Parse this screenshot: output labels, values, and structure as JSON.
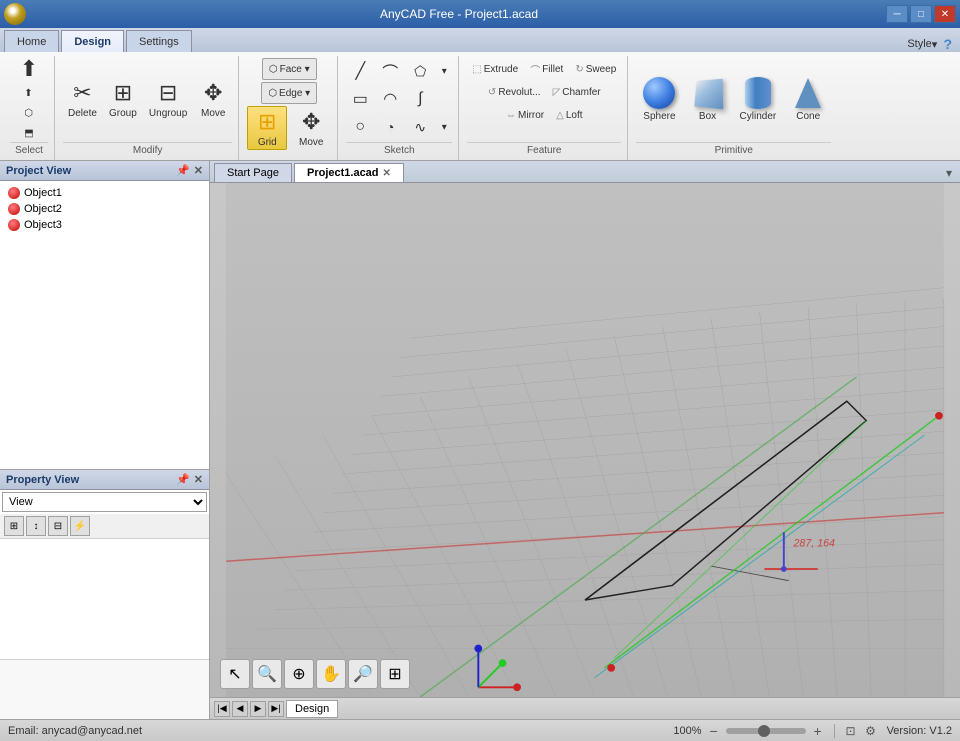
{
  "titlebar": {
    "title": "AnyCAD Free - Project1.acad",
    "minimize": "─",
    "maximize": "□",
    "close": "✕"
  },
  "ribbon": {
    "tabs": [
      "Home",
      "Design",
      "Settings"
    ],
    "active_tab": "Design",
    "style_label": "Style",
    "groups": {
      "select": {
        "label": "Select",
        "buttons": [
          "Select"
        ]
      },
      "modify": {
        "label": "Modify",
        "buttons": [
          "Delete",
          "Group",
          "Ungroup",
          "Move"
        ]
      },
      "grid": {
        "label": "",
        "buttons": [
          "Face ▾",
          "Edge ▾",
          "Grid",
          "Move"
        ]
      },
      "sketch": {
        "label": "Sketch"
      },
      "feature": {
        "label": "Feature",
        "buttons": [
          "Extrude",
          "Revolve",
          "Mirror",
          "Fillet",
          "Chamfer",
          "Loft",
          "Sweep"
        ]
      },
      "primitive": {
        "label": "Primitive",
        "buttons": [
          "Sphere",
          "Box",
          "Cylinder",
          "Cone"
        ]
      }
    }
  },
  "project_view": {
    "title": "Project View",
    "items": [
      "Object1",
      "Object2",
      "Object3"
    ]
  },
  "property_view": {
    "title": "Property View",
    "dropdown_value": "View",
    "toolbar_icons": [
      "grid-icon",
      "sort-icon",
      "table-icon",
      "lightning-icon"
    ]
  },
  "tabs": {
    "start_page": "Start Page",
    "project1": "Project1.acad"
  },
  "viewport": {
    "coord_label": "287, 164"
  },
  "status_bar": {
    "email": "Email: anycad@anycad.net",
    "zoom": "100%",
    "version": "Version: V1.2"
  },
  "nav_bar": {
    "design_tab": "Design"
  },
  "viewport_toolbar": {
    "buttons": [
      "cursor",
      "zoom-in",
      "zoom-fit",
      "pan",
      "zoom-window",
      "grid-view"
    ]
  }
}
